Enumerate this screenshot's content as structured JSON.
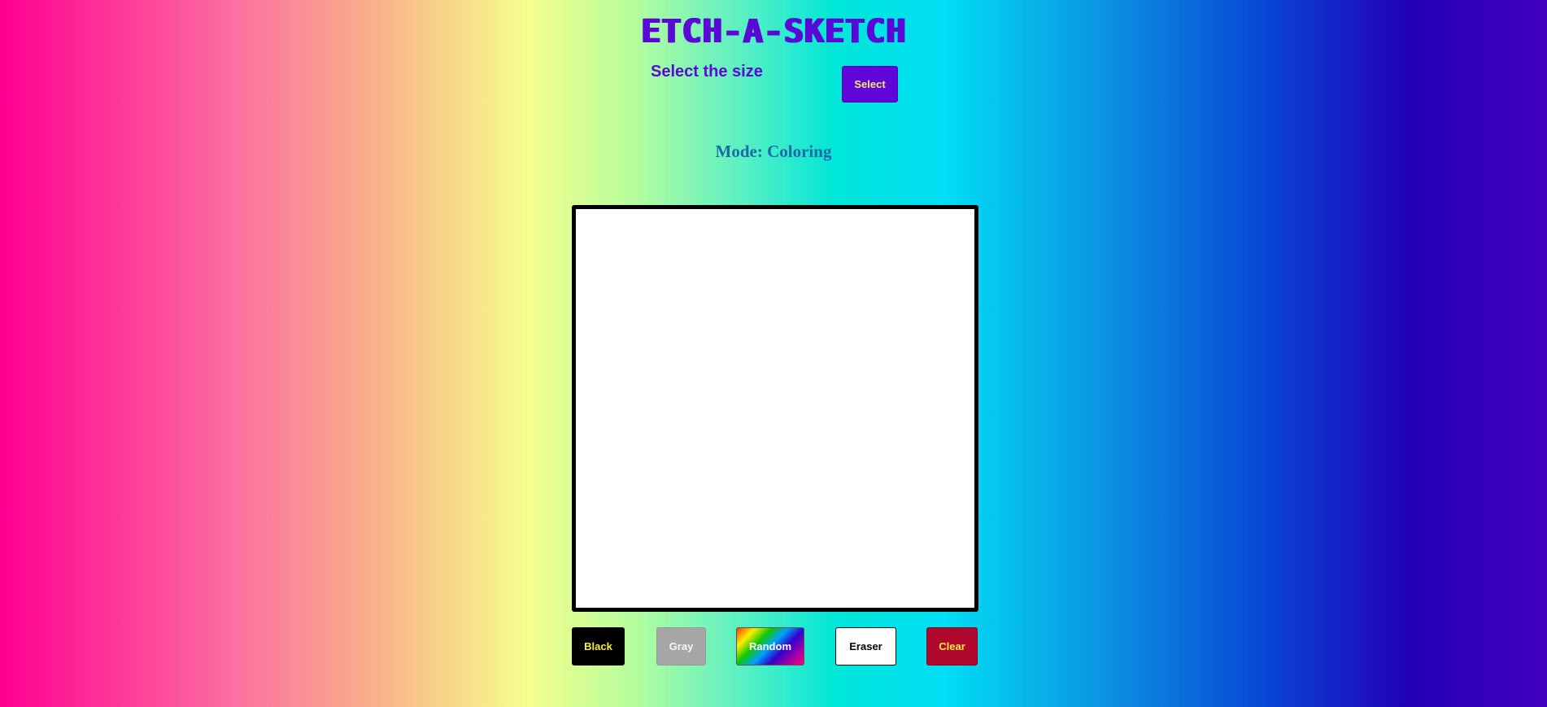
{
  "header": {
    "title": "ETCH-A-SKETCH"
  },
  "size_selector": {
    "label": "Select the size",
    "button_label": "Select"
  },
  "mode": {
    "text": "Mode: Coloring"
  },
  "controls": {
    "black_label": "Black",
    "gray_label": "Gray",
    "random_label": "Random",
    "eraser_label": "Eraser",
    "clear_label": "Clear"
  },
  "colors": {
    "accent": "#5a08d6",
    "black_button": "#000000",
    "gray_button": "#a6a6a6",
    "eraser_button": "#ffffff",
    "clear_button": "#b0072d",
    "button_text_yellow": "#f5ef3a"
  }
}
